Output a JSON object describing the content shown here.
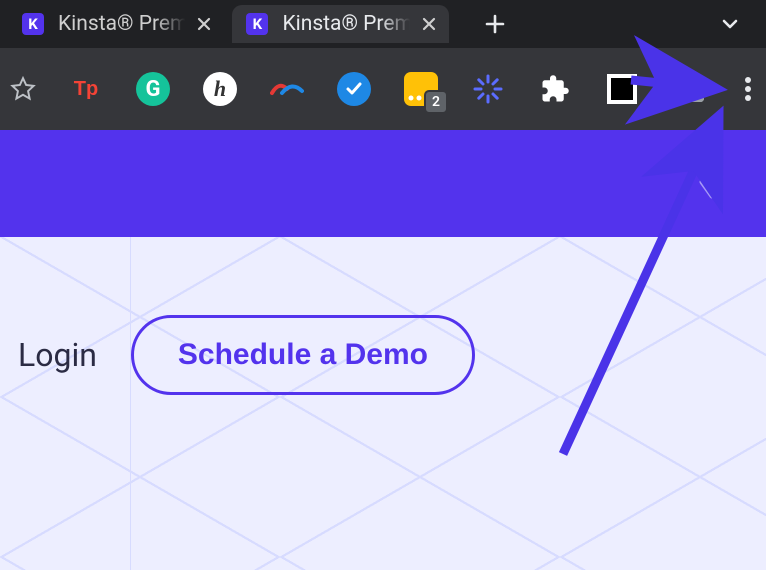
{
  "tabs": [
    {
      "favicon_letter": "K",
      "title": "Kinsta® Prem",
      "active": false
    },
    {
      "favicon_letter": "K",
      "title": "Kinsta® Prem",
      "active": true
    }
  ],
  "toolbar": {
    "extensions": {
      "tp_label": "Tp",
      "g_label": "G",
      "h_label": "h",
      "lp_badge": "2"
    }
  },
  "page": {
    "login_label": "Login",
    "demo_button_label": "Schedule a Demo"
  },
  "colors": {
    "brand_purple": "#5333ed",
    "chrome_dark": "#35363a",
    "tabstrip_dark": "#202124",
    "page_bg": "#edeeff",
    "annotation_arrow": "#4a33e8"
  }
}
